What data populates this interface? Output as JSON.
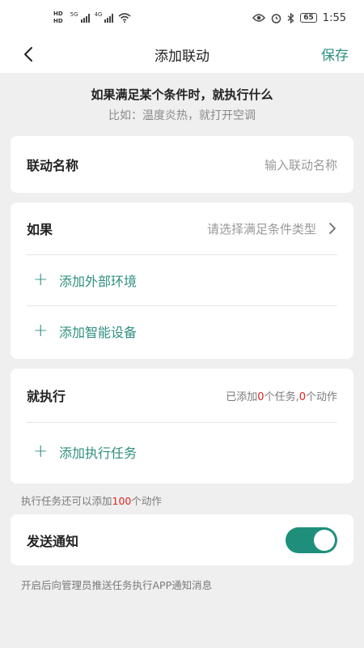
{
  "status_bar": {
    "hd1": "HD",
    "hd2": "HD",
    "net1": "5G",
    "net2": "4G",
    "battery": "65",
    "time": "1:55"
  },
  "nav": {
    "title": "添加联动",
    "save_label": "保存",
    "back_icon": "chevron-left-icon"
  },
  "intro": {
    "title": "如果满足某个条件时，就执行什么",
    "subtitle": "比如：温度炎热，就打开空调"
  },
  "name_section": {
    "label": "联动名称",
    "placeholder": "输入联动名称"
  },
  "if_section": {
    "label": "如果",
    "value_placeholder": "请选择满足条件类型",
    "add_environment": "添加外部环境",
    "add_device": "添加智能设备"
  },
  "then_section": {
    "label": "就执行",
    "count_prefix": "已添加",
    "task_count": "0",
    "task_unit": "个任务,",
    "action_count": "0",
    "action_unit": "个动作",
    "add_task": "添加执行任务"
  },
  "limit_hint": {
    "prefix": "执行任务还可以添加",
    "count": "100",
    "suffix": "个动作"
  },
  "notify": {
    "label": "发送通知",
    "enabled": true,
    "description": "开启后向管理员推送任务执行APP通知消息"
  },
  "colors": {
    "accent": "#2d8f80",
    "highlight": "#e02020",
    "background": "#efefef"
  }
}
